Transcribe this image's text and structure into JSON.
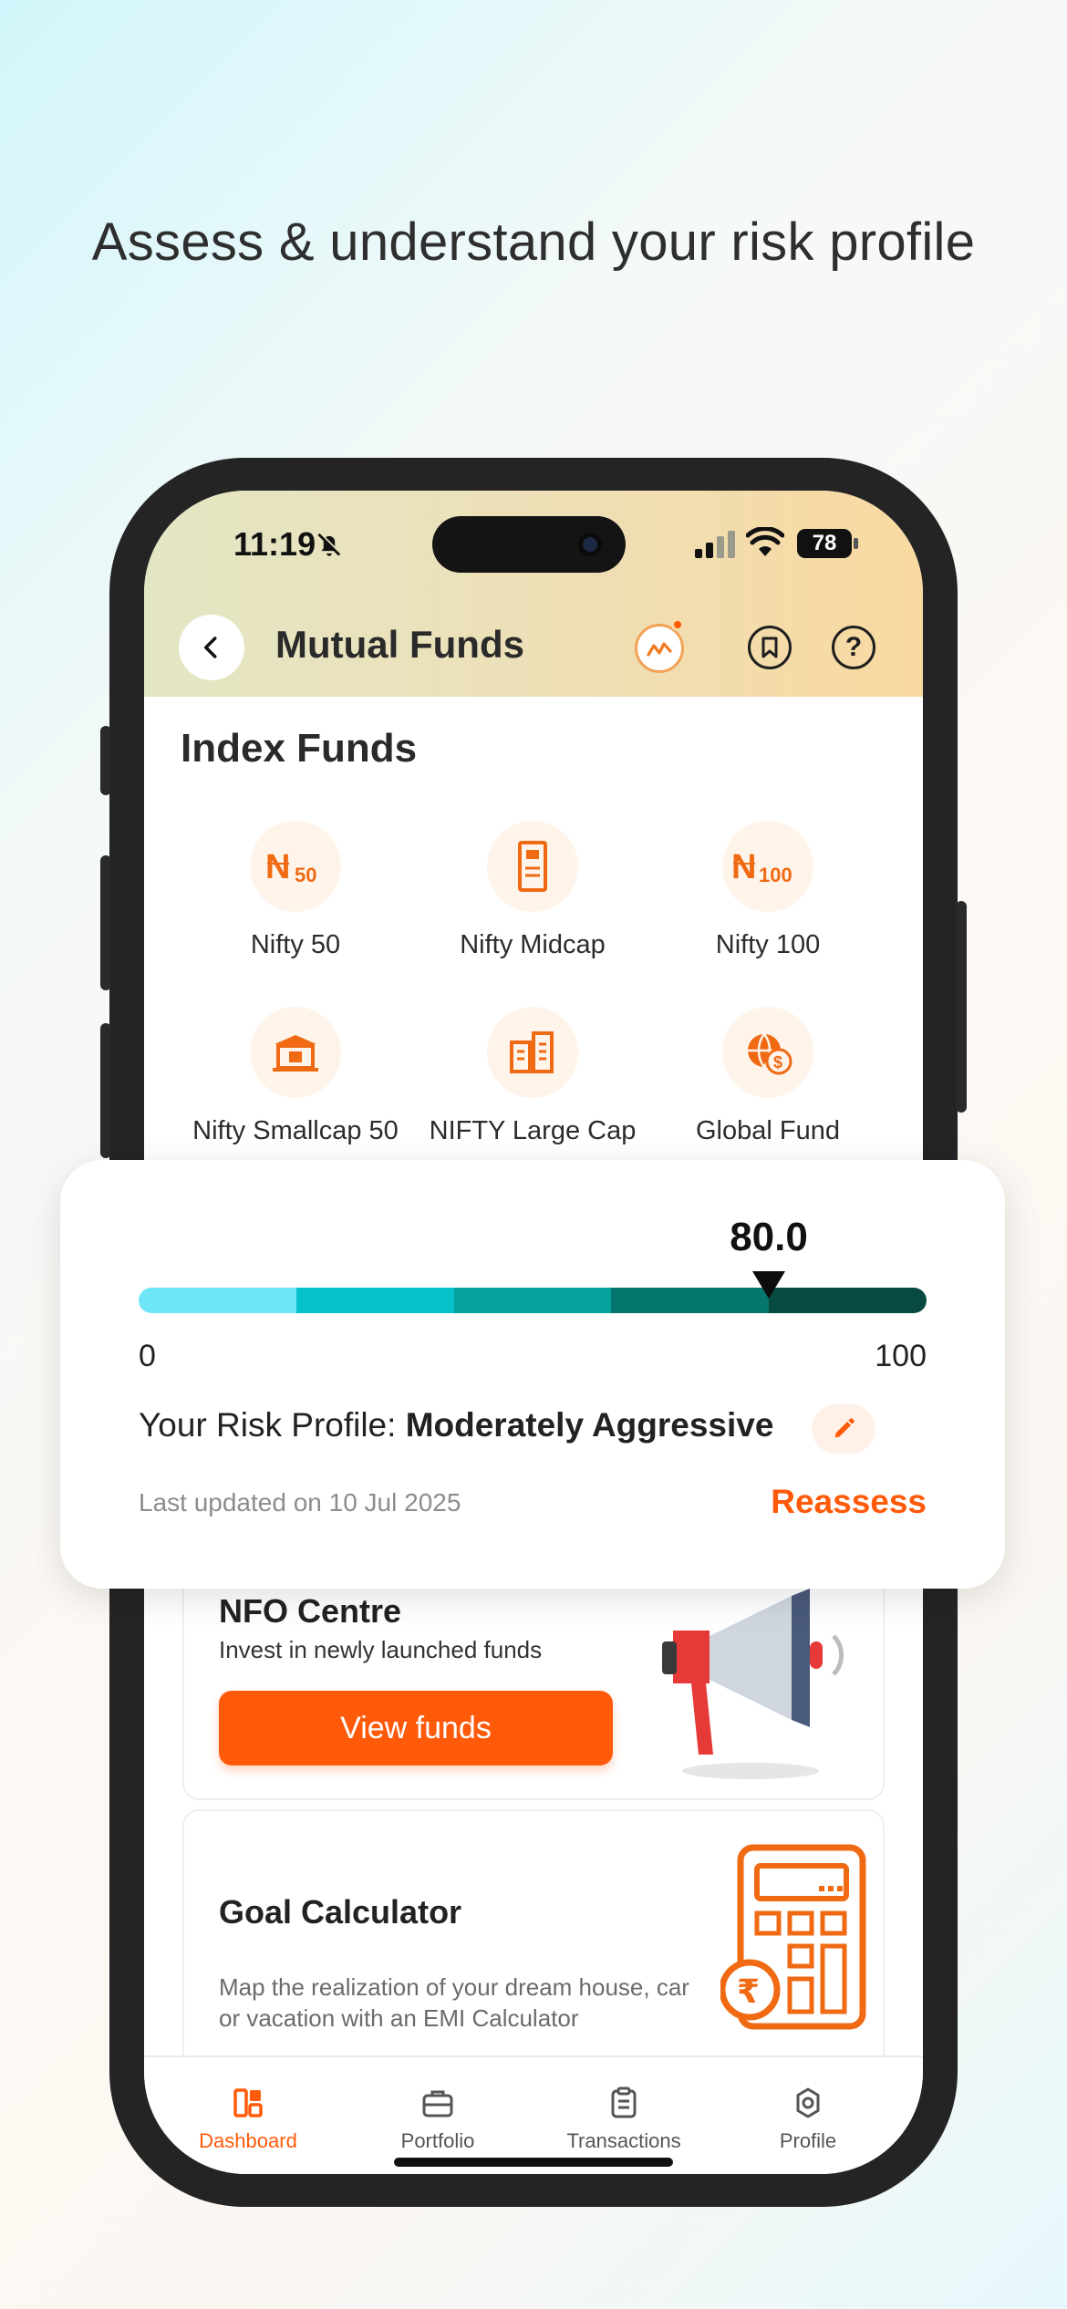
{
  "headline": "Assess & understand your risk profile",
  "status": {
    "time": "11:19",
    "battery": "78"
  },
  "header": {
    "title": "Mutual Funds"
  },
  "index_funds": {
    "title": "Index Funds",
    "items": [
      {
        "label": "Nifty 50",
        "icon": "nifty-50-icon"
      },
      {
        "label": "Nifty Midcap",
        "icon": "nifty-midcap-icon"
      },
      {
        "label": "Nifty 100",
        "icon": "nifty-100-icon"
      },
      {
        "label": "Nifty Smallcap 50",
        "icon": "nifty-smallcap-icon"
      },
      {
        "label": "NIFTY Large Cap",
        "icon": "nifty-large-cap-icon"
      },
      {
        "label": "Global Fund",
        "icon": "globe-dollar-icon"
      }
    ]
  },
  "risk": {
    "score": "80.0",
    "score_value": 80,
    "min": "0",
    "max": "100",
    "label_prefix": "Your Risk Profile: ",
    "label_value": "Moderately Aggressive",
    "updated": "Last updated on 10 Jul 2025",
    "reassess": "Reassess",
    "segment_colors": [
      "#6ee6f7",
      "#07c3c9",
      "#06a39d",
      "#05766d",
      "#084a41"
    ]
  },
  "nfo": {
    "title": "NFO Centre",
    "subtitle": "Invest in newly launched funds",
    "button": "View funds"
  },
  "goal": {
    "title": "Goal Calculator",
    "description": "Map the realization of your dream house, car or vacation with an EMI Calculator"
  },
  "tabs": [
    {
      "label": "Dashboard",
      "active": true
    },
    {
      "label": "Portfolio",
      "active": false
    },
    {
      "label": "Transactions",
      "active": false
    },
    {
      "label": "Profile",
      "active": false
    }
  ],
  "colors": {
    "accent": "#ff5a0a",
    "background": "#fdf8f3"
  }
}
